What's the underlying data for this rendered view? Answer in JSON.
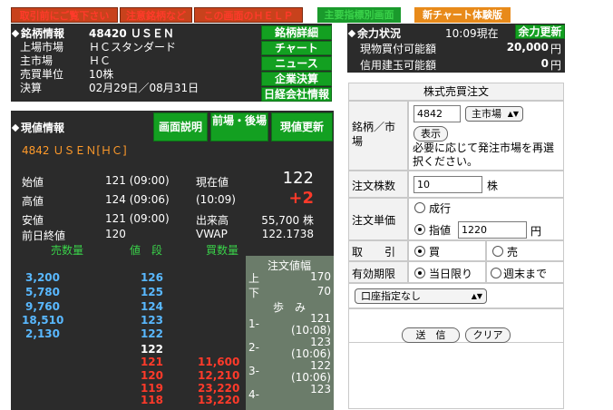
{
  "top_nav": {
    "btn1": "取引前にご覧下さい",
    "btn2": "注意銘柄など",
    "btn3": "この画面のＨＥＬＰ",
    "btn4": "主要指標別画面",
    "btn5": "新チャート体験版"
  },
  "brand": {
    "header": "銘柄情報",
    "code_name": "48420 ＵＳＥＮ",
    "market_label": "上場市場",
    "market_value": "ＨＣスタンダード",
    "main_market_label": "主市場",
    "main_market_value": "ＨＣ",
    "unit_label": "売買単位",
    "unit_value": "10株",
    "settle_label": "決算",
    "settle_value": "02月29日／08月31日",
    "buttons": [
      "銘柄詳細",
      "チャート",
      "ニュース",
      "企業決算",
      "日経会社情報"
    ]
  },
  "funds": {
    "header": "余力状況",
    "time": "10:09現在",
    "update_button": "余力更新",
    "cash_label": "現物買付可能額",
    "cash_value": "20,000",
    "cash_unit": "円",
    "margin_label": "信用建玉可能額",
    "margin_value": "0",
    "margin_unit": "円"
  },
  "quote": {
    "header": "現値情報",
    "btn_explain": "画面説明",
    "btn_session": "前場・後場",
    "btn_refresh": "現値更新",
    "symbol": "4842 ＵＳＥＮ[ＨＣ]",
    "open_label": "始値",
    "open_value": "121 (09:00)",
    "high_label": "高値",
    "high_value": "124 (09:06)",
    "low_label": "安値",
    "low_value": "121 (09:00)",
    "prev_label": "前日終値",
    "prev_value": "120",
    "price_label": "現在値",
    "price_value": "122",
    "price_time": "(10:09)",
    "change": "+2",
    "volume_label": "出来高",
    "volume_value": "55,700 株",
    "vwap_label": "VWAP",
    "vwap_value": "122.1738"
  },
  "board": {
    "sell_header": "売数量",
    "price_header": "値　段",
    "buy_header": "買数量",
    "sell_qty": [
      "3,200",
      "5,780",
      "9,760",
      "18,510",
      "2,130",
      "",
      "",
      "",
      "",
      ""
    ],
    "prices": [
      "126",
      "125",
      "124",
      "123",
      "122",
      "122",
      "121",
      "120",
      "119",
      "118"
    ],
    "buy_qty": [
      "",
      "",
      "",
      "",
      "",
      "",
      "11,600",
      "12,210",
      "23,220",
      "13,220"
    ]
  },
  "limits": {
    "header": "注文値幅",
    "upper_label": "上",
    "upper_value": "170",
    "lower_label": "下",
    "lower_value": "70",
    "walk_header": "歩　み",
    "walks": [
      {
        "n": "1-",
        "price": "121",
        "time": "(10:08)"
      },
      {
        "n": "2-",
        "price": "123",
        "time": "(10:06)"
      },
      {
        "n": "3-",
        "price": "122",
        "time": "(10:06)"
      },
      {
        "n": "4-",
        "price": "123",
        "time": ""
      }
    ]
  },
  "order": {
    "title": "株式売買注文",
    "symbol_label": "銘柄／市場",
    "symbol_value": "4842",
    "market_select": "主市場",
    "display_button": "表示",
    "note": "必要に応じて発注市場を再選択ください。",
    "qty_label": "注文株数",
    "qty_value": "10",
    "qty_unit": "株",
    "price_label": "注文単価",
    "market_order": "成行",
    "limit_order": "指値",
    "limit_value": "1220",
    "price_unit": "円",
    "side_label": "取　　引",
    "buy": "買",
    "sell": "売",
    "expiry_label": "有効期限",
    "today": "当日限り",
    "week": "週末まで",
    "account_select": "口座指定なし",
    "send_button": "送　信",
    "clear_button": "クリア"
  }
}
